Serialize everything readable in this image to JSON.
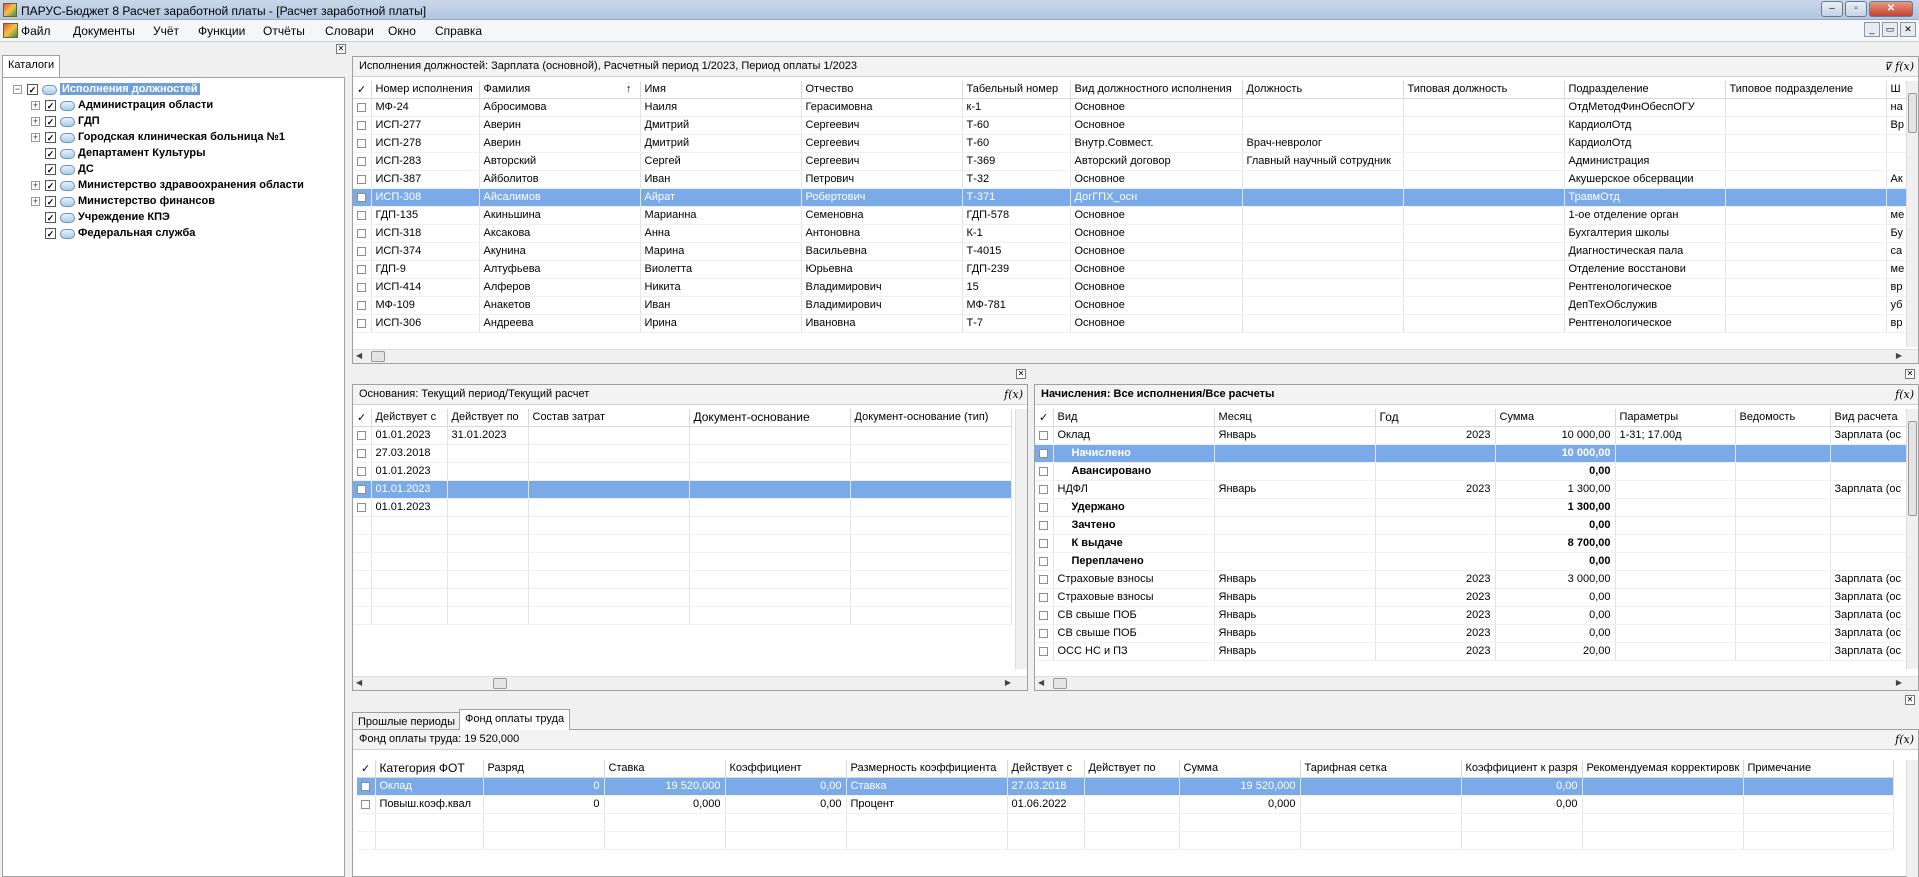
{
  "window": {
    "title": "ПАРУС-Бюджет 8 Расчет заработной платы - [Расчет заработной платы]"
  },
  "menu": [
    "Файл",
    "Документы",
    "Учёт",
    "Функции",
    "Отчёты",
    "Словари",
    "Окно",
    "Справка"
  ],
  "left": {
    "tab": "Каталоги",
    "root": "Исполнения должностей",
    "items": [
      {
        "label": "Администрация области",
        "exp": true
      },
      {
        "label": "ГДП",
        "exp": true
      },
      {
        "label": "Городская клиническая больница №1",
        "exp": true
      },
      {
        "label": "Департамент Культуры",
        "exp": false
      },
      {
        "label": "ДС",
        "exp": false
      },
      {
        "label": "Министерство здравоохранения области",
        "exp": true
      },
      {
        "label": "Министерство финансов",
        "exp": true
      },
      {
        "label": "Учреждение КПЭ",
        "exp": false
      },
      {
        "label": "Федеральная служба",
        "exp": false
      }
    ]
  },
  "top": {
    "header": "Исполнения должностей: Зарплата (основной), Расчетный период 1/2023, Период оплаты 1/2023",
    "columns": [
      "✓",
      "Номер исполнения",
      "Фамилия",
      "Имя",
      "Отчество",
      "Табельный номер",
      "Вид должностного исполнения",
      "Должность",
      "Типовая должность",
      "Подразделение",
      "Типовое подразделение",
      "Ш"
    ],
    "rows": [
      [
        "МФ-24",
        "Абросимова",
        "Наиля",
        "Герасимовна",
        "к-1",
        "Основное",
        "",
        "",
        "ОтдМетодФинОбеспОГУ",
        "",
        "на"
      ],
      [
        "ИСП-277",
        "Аверин",
        "Дмитрий",
        "Сергеевич",
        "Т-60",
        "Основное",
        "",
        "",
        "КардиолОтд",
        "",
        "Вр"
      ],
      [
        "ИСП-278",
        "Аверин",
        "Дмитрий",
        "Сергеевич",
        "Т-60",
        "Внутр.Совмест.",
        "Врач-невролог",
        "",
        "КардиолОтд",
        "",
        ""
      ],
      [
        "ИСП-283",
        "Авторский",
        "Сергей",
        "Сергеевич",
        "Т-369",
        "Авторский договор",
        "Главный научный сотрудник",
        "",
        "Администрация",
        "",
        ""
      ],
      [
        "ИСП-387",
        "Айболитов",
        "Иван",
        "Петрович",
        "Т-32",
        "Основное",
        "",
        "",
        "Акушерское обсервации",
        "",
        "Ак"
      ],
      [
        "ИСП-308",
        "Айсалимов",
        "Айрат",
        "Робертович",
        "Т-371",
        "ДогГПХ_осн",
        "",
        "",
        "ТравмОтд",
        "",
        ""
      ],
      [
        "ГДП-135",
        "Акиньшина",
        "Марианна",
        "Семеновна",
        "ГДП-578",
        "Основное",
        "",
        "",
        "1-ое отделение орган",
        "",
        "ме"
      ],
      [
        "ИСП-318",
        "Аксакова",
        "Анна",
        "Антоновна",
        "К-1",
        "Основное",
        "",
        "",
        "Бухгалтерия школы",
        "",
        "Бу"
      ],
      [
        "ИСП-374",
        "Акунина",
        "Марина",
        "Васильевна",
        "Т-4015",
        "Основное",
        "",
        "",
        "Диагностическая пала",
        "",
        "са"
      ],
      [
        "ГДП-9",
        "Алтуфьева",
        "Виолетта",
        "Юрьевна",
        "ГДП-239",
        "Основное",
        "",
        "",
        "Отделение восстанови",
        "",
        "ме"
      ],
      [
        "ИСП-414",
        "Алферов",
        "Никита",
        "Владимирович",
        "15",
        "Основное",
        "",
        "",
        "Рентгенологическое",
        "",
        "вр"
      ],
      [
        "МФ-109",
        "Анакетов",
        "Иван",
        "Владимирович",
        "МФ-781",
        "Основное",
        "",
        "",
        "ДепТехОбслужив",
        "",
        "уб"
      ],
      [
        "ИСП-306",
        "Андреева",
        "Ирина",
        "Ивановна",
        "Т-7",
        "Основное",
        "",
        "",
        "Рентгенологическое",
        "",
        "вр"
      ]
    ],
    "selected": 5,
    "sort_icon": "sort-up-icon"
  },
  "basis": {
    "header": "Основания: Текущий период/Текущий расчет",
    "columns": [
      "✓",
      "Действует с",
      "Действует по",
      "Состав затрат",
      "Документ-основание",
      "Документ-основание (тип)"
    ],
    "rows": [
      [
        "01.01.2023",
        "31.01.2023",
        "",
        "",
        ""
      ],
      [
        "27.03.2018",
        "",
        "",
        "",
        ""
      ],
      [
        "01.01.2023",
        "",
        "",
        "",
        ""
      ],
      [
        "01.01.2023",
        "",
        "",
        "",
        ""
      ],
      [
        "01.01.2023",
        "",
        "",
        "",
        ""
      ]
    ],
    "selected": 3
  },
  "accr": {
    "header": "Начисления: Все исполнения/Все расчеты",
    "columns": [
      "✓",
      "Вид",
      "Месяц",
      "Год",
      "Сумма",
      "Параметры",
      "Ведомость",
      "Вид расчета"
    ],
    "rows": [
      {
        "c": [
          "Оклад",
          "Январь",
          "2023",
          "10 000,00",
          "1-31; 17.00д",
          "",
          "Зарплата (ос"
        ],
        "b": false
      },
      {
        "c": [
          "Начислено",
          "",
          "",
          "10 000,00",
          "",
          "",
          ""
        ],
        "b": true
      },
      {
        "c": [
          "Авансировано",
          "",
          "",
          "0,00",
          "",
          "",
          ""
        ],
        "b": true
      },
      {
        "c": [
          "НДФЛ",
          "Январь",
          "2023",
          "1 300,00",
          "",
          "",
          "Зарплата (ос"
        ],
        "b": false
      },
      {
        "c": [
          "Удержано",
          "",
          "",
          "1 300,00",
          "",
          "",
          ""
        ],
        "b": true
      },
      {
        "c": [
          "Зачтено",
          "",
          "",
          "0,00",
          "",
          "",
          ""
        ],
        "b": true
      },
      {
        "c": [
          "К выдаче",
          "",
          "",
          "8 700,00",
          "",
          "",
          ""
        ],
        "b": true
      },
      {
        "c": [
          "Переплачено",
          "",
          "",
          "0,00",
          "",
          "",
          ""
        ],
        "b": true
      },
      {
        "c": [
          "Страховые взносы",
          "Январь",
          "2023",
          "3 000,00",
          "",
          "",
          "Зарплата (ос"
        ],
        "b": false
      },
      {
        "c": [
          "Страховые взносы",
          "Январь",
          "2023",
          "0,00",
          "",
          "",
          "Зарплата (ос"
        ],
        "b": false
      },
      {
        "c": [
          "СВ свыше ПОБ",
          "Январь",
          "2023",
          "0,00",
          "",
          "",
          "Зарплата (ос"
        ],
        "b": false
      },
      {
        "c": [
          "СВ свыше ПОБ",
          "Январь",
          "2023",
          "0,00",
          "",
          "",
          "Зарплата (ос"
        ],
        "b": false
      },
      {
        "c": [
          "ОСС НС и ПЗ",
          "Январь",
          "2023",
          "20,00",
          "",
          "",
          "Зарплата (ос"
        ],
        "b": false
      }
    ],
    "selected": 1
  },
  "bottom": {
    "tabs": [
      "Прошлые периоды",
      "Фонд оплаты труда"
    ],
    "active": 1,
    "header": "Фонд оплаты труда: 19 520,000",
    "columns": [
      "✓",
      "Категория ФОТ",
      "Разряд",
      "Ставка",
      "Коэффициент",
      "Размерность коэффициента",
      "Действует с",
      "Действует по",
      "Сумма",
      "Тарифная сетка",
      "Коэффициент к разря",
      "Рекомендуемая корректировк",
      "Примечание"
    ],
    "rows": [
      [
        "Оклад",
        "0",
        "19 520,000",
        "0,00",
        "Ставка",
        "27.03.2018",
        "",
        "19 520,000",
        "",
        "0,00",
        "",
        ""
      ],
      [
        "Повыш.коэф.квал",
        "0",
        "0,000",
        "0,00",
        "Процент",
        "01.06.2022",
        "",
        "0,000",
        "",
        "0,00",
        "",
        ""
      ]
    ],
    "selected": 0
  }
}
